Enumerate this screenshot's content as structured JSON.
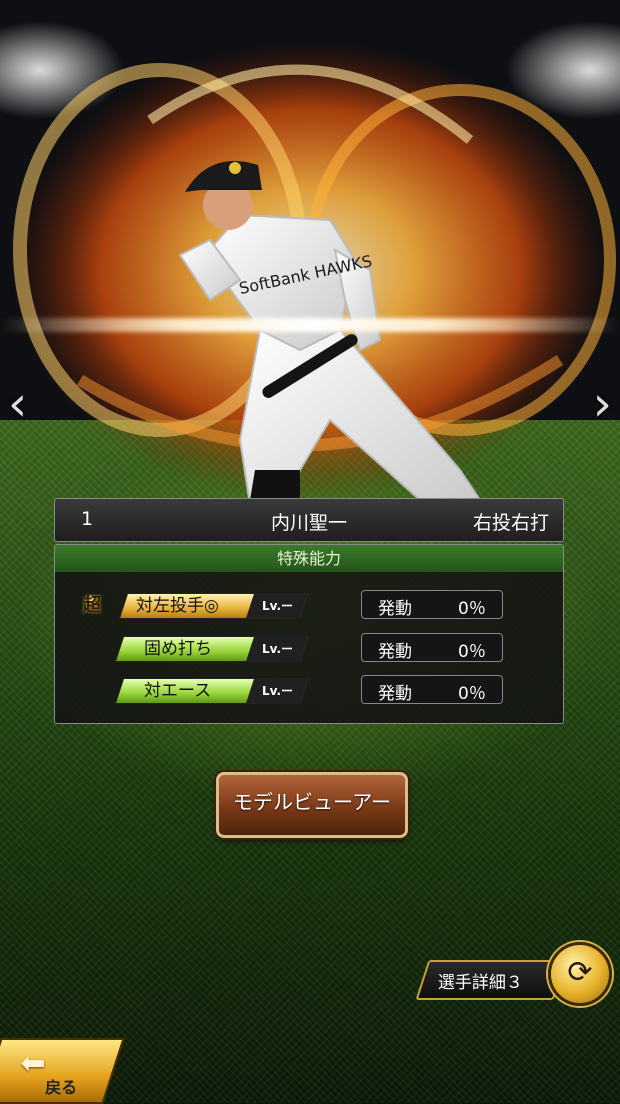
{
  "player": {
    "number": "1",
    "name": "内川聖一",
    "handedness": "右投右打",
    "jersey_text": "SoftBank HAWKS"
  },
  "abilities": {
    "header": "特殊能力",
    "items": [
      {
        "prefix": "超",
        "name": "対左投手◎",
        "level": "Lv.ー",
        "activate_label": "発動",
        "activate_value": "0％",
        "style": "gold"
      },
      {
        "prefix": "",
        "name": "固め打ち",
        "level": "Lv.ー",
        "activate_label": "発動",
        "activate_value": "0％",
        "style": "green"
      },
      {
        "prefix": "",
        "name": "対エース",
        "level": "Lv.ー",
        "activate_label": "発動",
        "activate_value": "0％",
        "style": "green"
      }
    ]
  },
  "buttons": {
    "model_viewer": "モデルビューアー",
    "player_detail": "選手詳細３",
    "back": "戻る"
  },
  "icons": {
    "prev": "chevron-left-icon",
    "next": "chevron-right-icon",
    "refresh": "refresh-icon",
    "back": "back-arrow-icon"
  },
  "colors": {
    "ability_header": "#2f6b22",
    "gold_badge": "#e7b23a",
    "green_badge": "#98d43a",
    "model_button": "#7a3a18"
  }
}
